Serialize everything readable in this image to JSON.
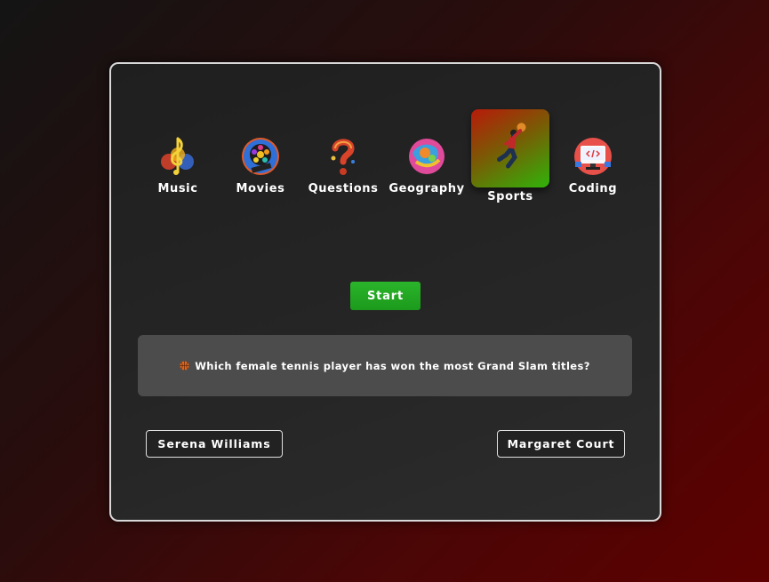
{
  "categories": [
    {
      "label": "Music",
      "icon": "music-note-icon",
      "active": false
    },
    {
      "label": "Movies",
      "icon": "film-reel-icon",
      "active": false
    },
    {
      "label": "Questions",
      "icon": "question-mark-icon",
      "active": false
    },
    {
      "label": "Geography",
      "icon": "globe-icon",
      "active": false
    },
    {
      "label": "Sports",
      "icon": "basketball-player-icon",
      "active": true
    },
    {
      "label": "Coding",
      "icon": "computer-icon",
      "active": false
    }
  ],
  "start_label": "Start",
  "question": {
    "icon": "basketball-icon",
    "text": "Which female tennis player has won the most Grand Slam titles?"
  },
  "answers": [
    "Serena Williams",
    "Margaret Court"
  ],
  "colors": {
    "accent_green": "#22a722",
    "question_bg": "#4c4c4c",
    "card_border": "#d8d8d8"
  }
}
